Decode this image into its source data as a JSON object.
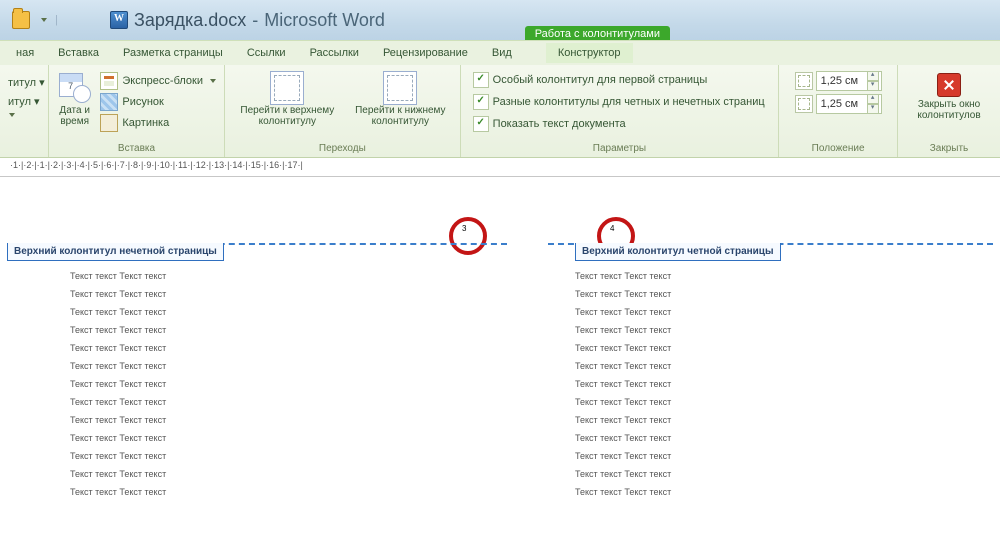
{
  "title": {
    "doc": "Зарядка.docx",
    "sep": "-",
    "app": "Microsoft Word"
  },
  "context_tab": "Работа с колонтитулами",
  "tabs": {
    "t0": "ная",
    "t1": "Вставка",
    "t2": "Разметка страницы",
    "t3": "Ссылки",
    "t4": "Рассылки",
    "t5": "Рецензирование",
    "t6": "Вид",
    "t7": "Конструктор"
  },
  "groups": {
    "g0": {
      "label": "",
      "btn1": "титул ▾",
      "btn2": "итул ▾"
    },
    "g1": {
      "label": "Вставка",
      "datetime_l1": "Дата и",
      "datetime_l2": "время",
      "blocks": "Экспресс-блоки",
      "picture": "Рисунок",
      "clipart": "Картинка"
    },
    "g2": {
      "label": "Переходы",
      "goto_top_l1": "Перейти к верхнему",
      "goto_top_l2": "колонтитулу",
      "goto_bot_l1": "Перейти к нижнему",
      "goto_bot_l2": "колонтитулу"
    },
    "g3": {
      "label": "Параметры",
      "cb1": "Особый колонтитул для первой страницы",
      "cb2": "Разные колонтитулы для четных и нечетных страниц",
      "cb3": "Показать текст документа"
    },
    "g4": {
      "label": "Положение",
      "val1": "1,25 см",
      "val2": "1,25 см"
    },
    "g5": {
      "label": "Закрыть",
      "btn_l1": "Закрыть окно",
      "btn_l2": "колонтитулов"
    }
  },
  "ruler": "·1·|·2·|·1·|·2·|·3·|·4·|·5·|·6·|·7·|·8·|·9·|·10·|·11·|·12·|·13·|·14·|·15·|·16·|·17·|",
  "pages": {
    "left": {
      "num": "3",
      "flag": "Верхний колонтитул нечетной страницы"
    },
    "right": {
      "num": "4",
      "flag": "Верхний колонтитул четной страницы"
    }
  },
  "bodyline": "Текст текст Текст текст",
  "line_count": 13
}
